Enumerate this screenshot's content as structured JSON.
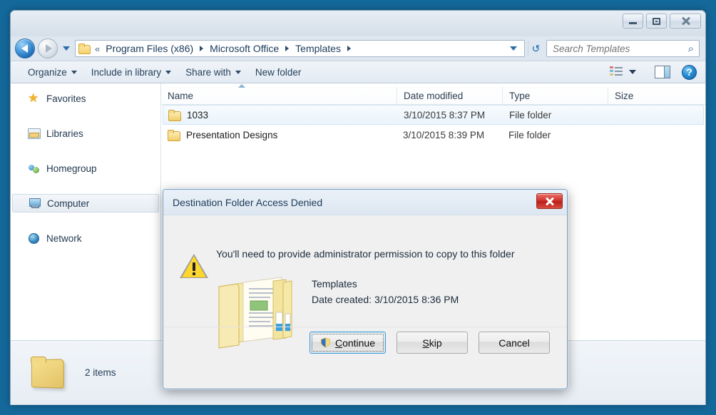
{
  "desktop": {
    "background_color": "#14699b"
  },
  "window": {
    "controls": {
      "minimize_label": "Minimize",
      "maximize_label": "Maximize",
      "close_label": "Close"
    }
  },
  "navigation": {
    "back_label": "Back",
    "forward_label": "Forward",
    "recent_pages_label": "Recent pages",
    "refresh_label": "Refresh",
    "refresh_glyph": "↺"
  },
  "breadcrumb": {
    "overflow_glyph": "«",
    "crumbs": [
      {
        "label": "Program Files (x86)"
      },
      {
        "label": "Microsoft Office"
      },
      {
        "label": "Templates"
      }
    ]
  },
  "search": {
    "placeholder": "Search Templates",
    "value": "",
    "icon": "search-icon",
    "icon_glyph": "⌕"
  },
  "toolbar": {
    "items": [
      {
        "label": "Organize",
        "has_caret": true
      },
      {
        "label": "Include in library",
        "has_caret": true
      },
      {
        "label": "Share with",
        "has_caret": true
      },
      {
        "label": "New folder",
        "has_caret": false
      }
    ],
    "view_icon": "change-view-icon",
    "preview_icon": "preview-pane-icon",
    "help_icon": "help-icon",
    "help_glyph": "?"
  },
  "sidebar": {
    "items": [
      {
        "label": "Favorites",
        "icon": "star-icon",
        "selected": false
      },
      {
        "label": "Libraries",
        "icon": "library-icon",
        "selected": false
      },
      {
        "label": "Homegroup",
        "icon": "homegroup-icon",
        "selected": false
      },
      {
        "label": "Computer",
        "icon": "computer-icon",
        "selected": true
      },
      {
        "label": "Network",
        "icon": "network-icon",
        "selected": false
      }
    ]
  },
  "file_list": {
    "columns": [
      {
        "label": "Name",
        "sorted": true
      },
      {
        "label": "Date modified",
        "sorted": false
      },
      {
        "label": "Type",
        "sorted": false
      },
      {
        "label": "Size",
        "sorted": false
      }
    ],
    "rows": [
      {
        "name": "1033",
        "date_modified": "3/10/2015 8:37 PM",
        "type": "File folder",
        "size": "",
        "selected": true
      },
      {
        "name": "Presentation Designs",
        "date_modified": "3/10/2015 8:39 PM",
        "type": "File folder",
        "size": "",
        "selected": false
      }
    ]
  },
  "status_bar": {
    "item_count": "2 items",
    "folder_icon": "folder-icon"
  },
  "dialog": {
    "title": "Destination Folder Access Denied",
    "close_label": "Close",
    "message": "You'll need to provide administrator permission to copy to this folder",
    "folder_name": "Templates",
    "date_created": "Date created: 3/10/2015 8:36 PM",
    "warning_icon": "warning-triangle-icon",
    "folder_graphic": "open-folder-icon",
    "buttons": [
      {
        "label": "Continue",
        "accesskey": "C",
        "rest": "ontinue",
        "shield": true,
        "default": true
      },
      {
        "label": "Skip",
        "accesskey": "S",
        "rest": "kip",
        "shield": false,
        "default": false
      },
      {
        "label": "Cancel",
        "accesskey": "",
        "rest": "Cancel",
        "shield": false,
        "default": false
      }
    ]
  }
}
